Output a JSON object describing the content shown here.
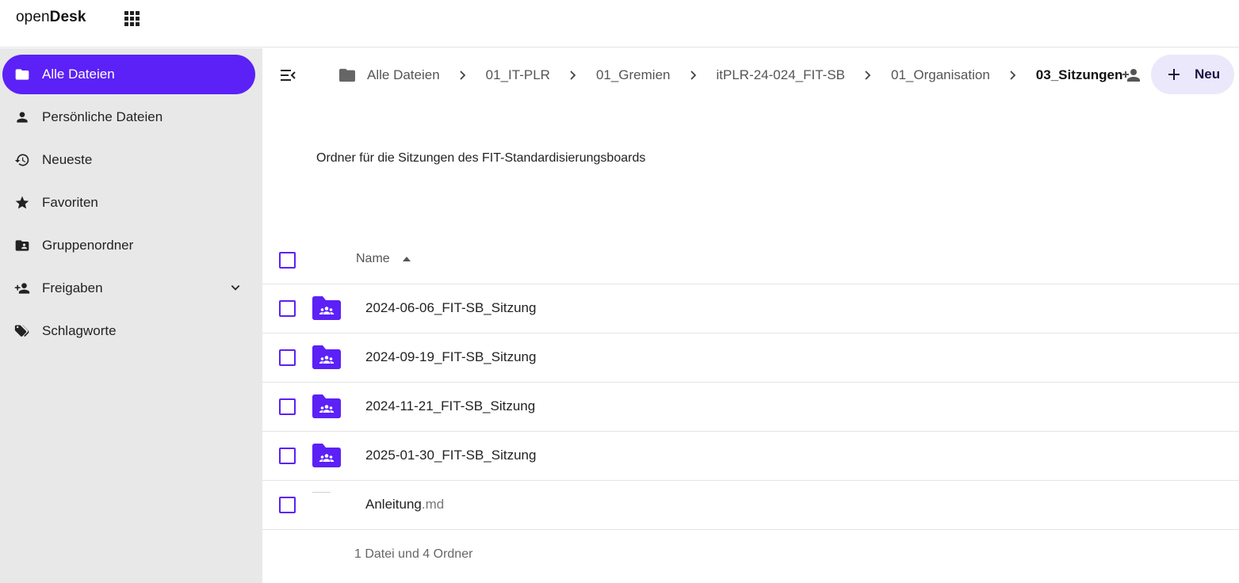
{
  "header": {
    "logo_light": "open",
    "logo_bold": "Desk",
    "apps_icon": "grid-icon"
  },
  "sidebar": {
    "items": [
      {
        "label": "Alle Dateien",
        "icon": "folder-icon",
        "active": true
      },
      {
        "label": "Persönliche Dateien",
        "icon": "person-icon",
        "active": false
      },
      {
        "label": "Neueste",
        "icon": "history-icon",
        "active": false
      },
      {
        "label": "Favoriten",
        "icon": "star-icon",
        "active": false
      },
      {
        "label": "Gruppenordner",
        "icon": "group-folder-icon",
        "active": false
      },
      {
        "label": "Freigaben",
        "icon": "share-person-icon",
        "active": false,
        "expandable": true
      },
      {
        "label": "Schlagworte",
        "icon": "tags-icon",
        "active": false
      }
    ]
  },
  "breadcrumb": [
    {
      "label": "Alle Dateien",
      "current": false
    },
    {
      "label": "01_IT-PLR",
      "current": false
    },
    {
      "label": "01_Gremien",
      "current": false
    },
    {
      "label": "itPLR-24-024_FIT-SB",
      "current": false
    },
    {
      "label": "01_Organisation",
      "current": false
    },
    {
      "label": "03_Sitzungen",
      "current": true
    }
  ],
  "toolbar": {
    "new_label": "Neu"
  },
  "description": "Ordner für die Sitzungen des FIT-Standardisierungsboards",
  "table": {
    "name_header": "Name",
    "rows": [
      {
        "name": "2024-06-06_FIT-SB_Sitzung",
        "ext": "",
        "type": "group-folder"
      },
      {
        "name": "2024-09-19_FIT-SB_Sitzung",
        "ext": "",
        "type": "group-folder"
      },
      {
        "name": "2024-11-21_FIT-SB_Sitzung",
        "ext": "",
        "type": "group-folder"
      },
      {
        "name": "2025-01-30_FIT-SB_Sitzung",
        "ext": "",
        "type": "group-folder"
      },
      {
        "name": "Anleitung",
        "ext": ".md",
        "type": "file"
      }
    ],
    "summary": "1 Datei und 4 Ordner"
  },
  "colors": {
    "accent": "#5b21f6",
    "sidebar_bg": "#e8e8e8",
    "new_button_bg": "#ece8fb"
  }
}
